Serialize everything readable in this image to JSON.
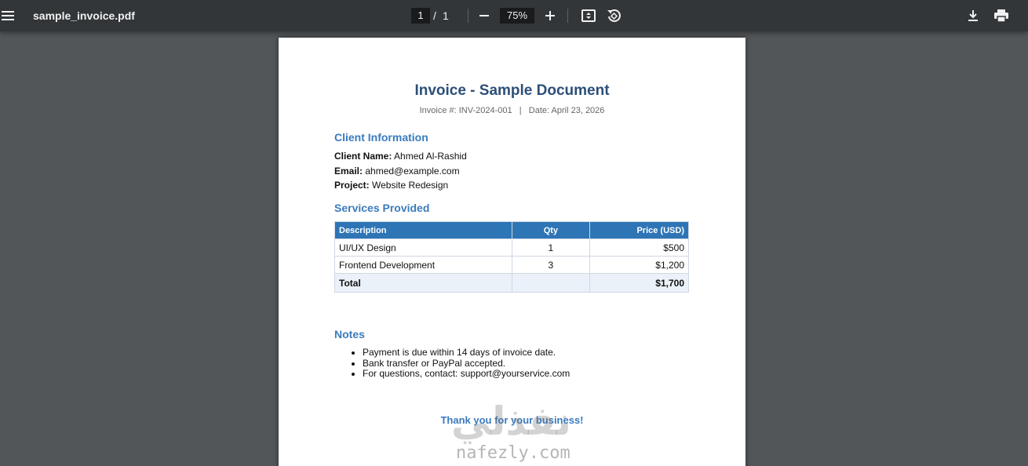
{
  "toolbar": {
    "file_name": "sample_invoice.pdf",
    "current_page": "1",
    "page_separator": "/",
    "total_pages": "1",
    "zoom": "75%"
  },
  "document": {
    "title": "Invoice - Sample Document",
    "meta": "Invoice #: INV-2024-001   |   Date: April 23, 2026",
    "client_section": "Client Information",
    "client": {
      "name_label": "Client Name:",
      "name_value": " Ahmed Al-Rashid",
      "email_label": "Email:",
      "email_value": " ahmed@example.com",
      "project_label": "Project:",
      "project_value": " Website Redesign"
    },
    "services_section": "Services Provided",
    "table": {
      "headers": [
        "Description",
        "Qty",
        "Price (USD)"
      ],
      "rows": [
        [
          "UI/UX Design",
          "1",
          "$500"
        ],
        [
          "Frontend Development",
          "3",
          "$1,200"
        ]
      ],
      "total_label": "Total",
      "total_qty": "",
      "total_value": "$1,700"
    },
    "notes_section": "Notes",
    "notes": [
      "Payment is due within 14 days of invoice date.",
      "Bank transfer or PayPal accepted.",
      "For questions, contact: support@yourservice.com"
    ],
    "thanks": "Thank you for your business!"
  },
  "watermark": {
    "arabic": "نفذلي",
    "latin": "nafezly.com"
  },
  "colors": {
    "toolbar_bg": "#323639",
    "viewer_bg": "#525659",
    "title": "#2c4f78",
    "section": "#3a7bbd",
    "table_header": "#2e75b6"
  },
  "icons": [
    "menu-icon",
    "zoom-out-icon",
    "zoom-in-icon",
    "fit-page-icon",
    "rotate-icon",
    "download-icon",
    "print-icon"
  ]
}
